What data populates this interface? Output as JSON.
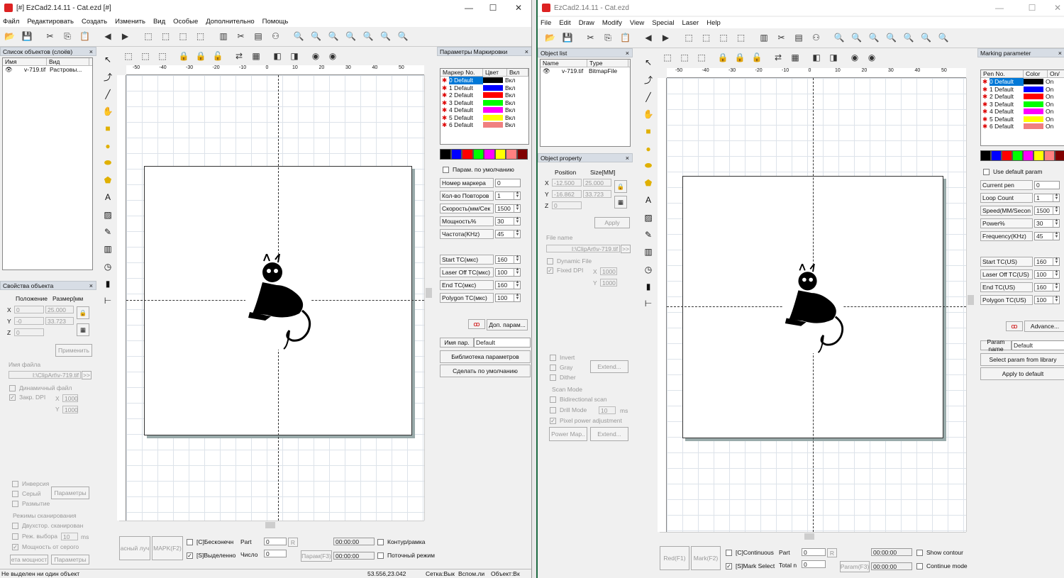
{
  "left": {
    "title": "[#] EzCad2.14.11 - Cat.ezd [#]",
    "menu": [
      "Файл",
      "Редактировать",
      "Создать",
      "Изменить",
      "Вид",
      "Особые",
      "Дополнительно",
      "Помощь"
    ],
    "object_list": {
      "title": "Список объектов (слоёв)",
      "col_name": "Имя",
      "col_type": "Вид",
      "item_name": "v-719.tif",
      "item_type": "Растровы..."
    },
    "object_property": {
      "title": "Свойства объекта",
      "position": "Положение",
      "size": "Размер[мм",
      "x": "0",
      "y": "-0",
      "z": "0",
      "sx": "25.000",
      "sy": "33.723",
      "apply": "Применить",
      "file_name": "Имя файла",
      "file_path": "I:\\ClipArt\\v-719.tif",
      "dynamic": "Динамичный файл",
      "fixed_dpi": "Закр. DPI",
      "dpi_x": "1000",
      "dpi_y": "1000"
    },
    "image_opts": {
      "invert": "Инверсия",
      "gray": "Серый",
      "dither": "Размытие",
      "params": "Параметры",
      "scan_mode": "Режимы сканирования",
      "bidir": "Двухстор. сканирован",
      "drill": "Реж. выбора",
      "drill_val": "10",
      "drill_unit": "ms",
      "pixel_power": "Мощность от серого",
      "power_map": "ета мощност",
      "extend": "Параметры"
    },
    "marking": {
      "title": "Параметры Маркировки",
      "col_pen": "Маркер No.",
      "col_color": "Цвет",
      "col_on": "Вкл",
      "on": "Вкл",
      "use_default": "Парам. по умолчанию",
      "current_pen": "Номер маркера",
      "current_pen_val": "0",
      "loop": "Кол-во Повторов",
      "loop_val": "1",
      "speed": "Скорость(мм/Сек",
      "speed_val": "1500",
      "power": "Мощность%",
      "power_val": "30",
      "freq": "Частота(KHz)",
      "freq_val": "45",
      "start_tc": "Start TC(мкс)",
      "start_tc_val": "160",
      "laser_off": "Laser Off TC(мкс)",
      "laser_off_val": "100",
      "end_tc": "End TC(мкс)",
      "end_tc_val": "160",
      "polygon": "Polygon TC(мкс)",
      "polygon_val": "100",
      "advance": "Доп. парам...",
      "param_name": "Имя пар.",
      "param_name_val": "Default",
      "library": "Библиотека параметров",
      "set_default": "Сделать по умолчанию"
    },
    "bottom": {
      "red": "асный луч",
      "mark": "MAPK(F2)",
      "continuous": "[С]Бесконечн",
      "selected": "[S]Выделенно",
      "part": "Part",
      "count": "Число",
      "part_val": "0",
      "count_val": "0",
      "r": "R",
      "time1": "00:00:00",
      "time2": "00:00:00",
      "params": "Парам(F3)",
      "contour": "Контур/рамка",
      "flow": "Поточный режим"
    },
    "status": {
      "msg": "Не выделен ни один объект",
      "coords": "53.556,23.042",
      "grid": "Сетка:Вык",
      "guide": "Вспом.ли",
      "obj": "Объект:Вк"
    }
  },
  "right": {
    "title": "EzCad2.14.11 - Cat.ezd",
    "menu": [
      "File",
      "Edit",
      "Draw",
      "Modify",
      "View",
      "Special",
      "Laser",
      "Help"
    ],
    "object_list": {
      "title": "Object list",
      "col_name": "Name",
      "col_type": "Type",
      "item_name": "v-719.tif",
      "item_type": "BitmapFile"
    },
    "object_property": {
      "title": "Object property",
      "position": "Position",
      "size": "Size[MM]",
      "x": "-12.500",
      "y": "-16.862",
      "z": "0",
      "sx": "25.000",
      "sy": "33.723",
      "apply": "Apply",
      "file_name": "File name",
      "file_path": "I:\\ClipArt\\v-719.tif",
      "dynamic": "Dynamic File",
      "fixed_dpi": "Fixed DPI",
      "dpi_x": "1000",
      "dpi_y": "1000"
    },
    "image_opts": {
      "invert": "Invert",
      "gray": "Gray",
      "dither": "Dither",
      "extend": "Extend...",
      "scan_mode": "Scan Mode",
      "bidir": "Bidirectional scan",
      "drill": "Drill Mode",
      "drill_val": "10",
      "drill_unit": "ms",
      "pixel_power": "Pixel power adjustment",
      "power_map": "Power Map..",
      "extend2": "Extend..."
    },
    "marking": {
      "title": "Marking parameter",
      "col_pen": "Pen No.",
      "col_color": "Color",
      "col_on": "On/",
      "on": "On",
      "use_default": "Use default param",
      "current_pen": "Current pen",
      "current_pen_val": "0",
      "loop": "Loop Count",
      "loop_val": "1",
      "speed": "Speed(MM/Secon",
      "speed_val": "1500",
      "power": "Power%",
      "power_val": "30",
      "freq": "Frequency(KHz)",
      "freq_val": "45",
      "start_tc": "Start TC(US)",
      "start_tc_val": "160",
      "laser_off": "Laser Off TC(US)",
      "laser_off_val": "100",
      "end_tc": "End TC(US)",
      "end_tc_val": "160",
      "polygon": "Polygon TC(US)",
      "polygon_val": "100",
      "advance": "Advance...",
      "param_name": "Param name",
      "param_name_val": "Default",
      "library": "Select param from library",
      "set_default": "Apply to default"
    },
    "bottom": {
      "red": "Red(F1)",
      "mark": "Mark(F2)",
      "continuous": "[C]Continuous",
      "selected": "[S]Mark Select",
      "part": "Part",
      "count": "Total n",
      "part_val": "0",
      "count_val": "0",
      "r": "R",
      "time1": "00:00:00",
      "time2": "00:00:00",
      "params": "Param(F3)",
      "contour": "Show contour",
      "flow": "Continue mode"
    }
  },
  "pens": [
    {
      "name": "0 Default",
      "color": "#000000"
    },
    {
      "name": "1 Default",
      "color": "#0000ff"
    },
    {
      "name": "2 Default",
      "color": "#ff0000"
    },
    {
      "name": "3 Default",
      "color": "#00ff00"
    },
    {
      "name": "4 Default",
      "color": "#ff00ff"
    },
    {
      "name": "5 Default",
      "color": "#ffff00"
    },
    {
      "name": "6 Default",
      "color": "#f08080"
    }
  ],
  "palette": [
    "#000000",
    "#0000ff",
    "#ff0000",
    "#00ff00",
    "#ff00ff",
    "#ffff00",
    "#ff8080",
    "#800000"
  ],
  "ruler_labels": [
    "-50",
    "-40",
    "-30",
    "-20",
    "-10",
    "0",
    "10",
    "20",
    "30",
    "40",
    "50"
  ],
  "colors": {
    "accent": "#0078d7",
    "title_bar": "#ffffff",
    "panel": "#f0f0f0"
  }
}
